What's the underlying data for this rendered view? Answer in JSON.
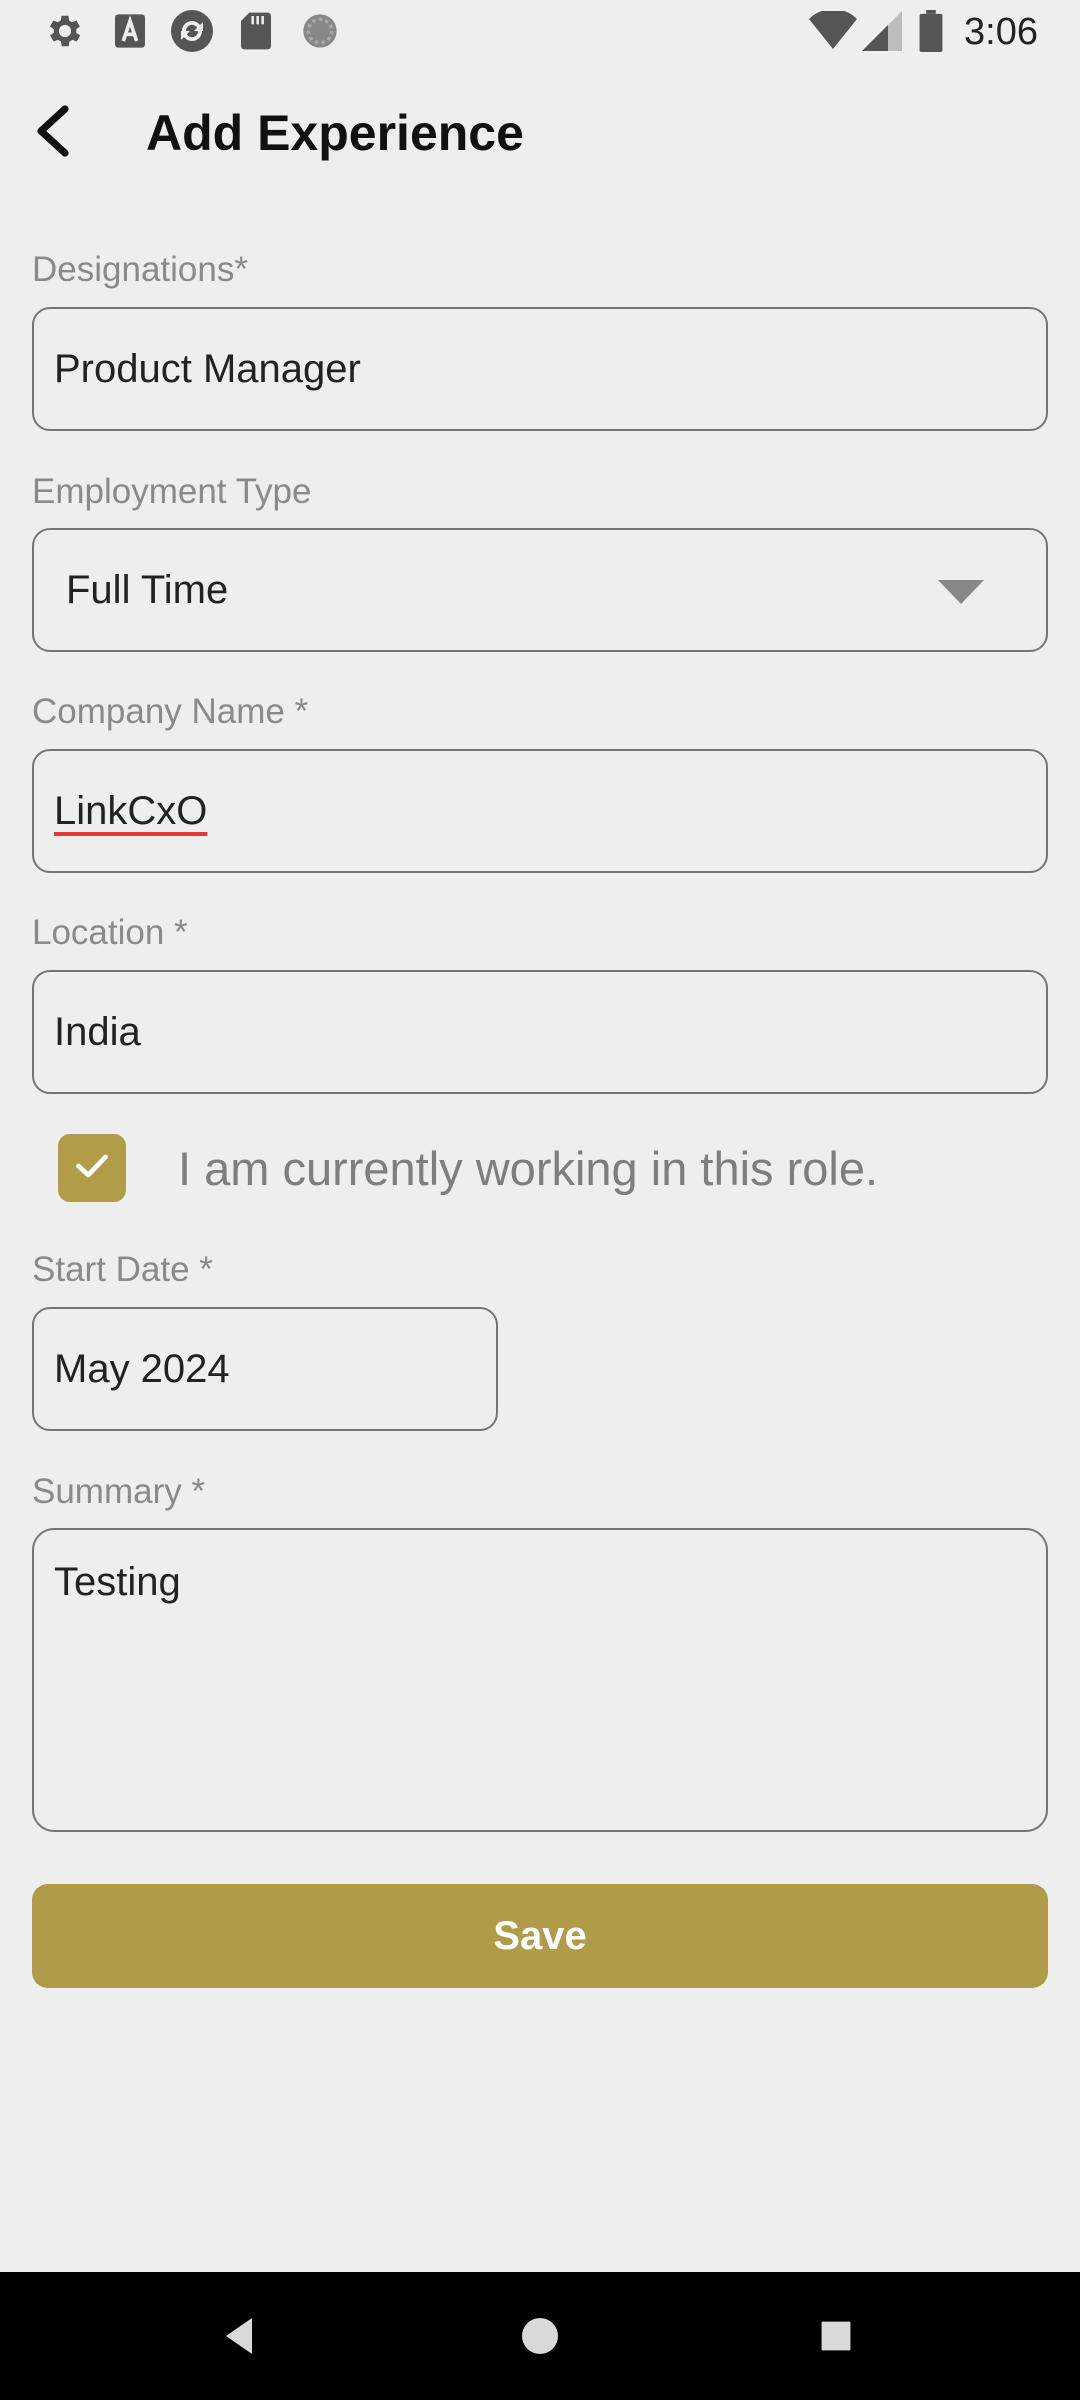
{
  "status_bar": {
    "time": "3:06",
    "left_icons": [
      "settings-icon",
      "font-a-icon",
      "sync-icon",
      "sd-card-icon",
      "loading-icon"
    ],
    "right_icons": [
      "wifi-icon",
      "signal-icon",
      "battery-icon"
    ]
  },
  "header": {
    "back_icon": "arrow-back-icon",
    "title": "Add Experience"
  },
  "form": {
    "designation": {
      "label": "Designations*",
      "value": "Product Manager"
    },
    "employment_type": {
      "label": "Employment Type",
      "value": "Full Time"
    },
    "company_name": {
      "label": "Company Name *",
      "value": "LinkCxO"
    },
    "location": {
      "label": "Location *",
      "value": "India"
    },
    "current_role": {
      "label": "I am currently working in this role.",
      "checked": true
    },
    "start_date": {
      "label": "Start Date *",
      "value": "May 2024"
    },
    "summary": {
      "label": "Summary *",
      "value": "Testing"
    }
  },
  "save_button": {
    "label": "Save"
  },
  "colors": {
    "accent": "#b09b48",
    "background": "#eeeeee",
    "label": "#8a8a8a",
    "border": "#757575"
  },
  "nav_bar": {
    "buttons": [
      "back-triangle-icon",
      "home-circle-icon",
      "recents-square-icon"
    ]
  }
}
